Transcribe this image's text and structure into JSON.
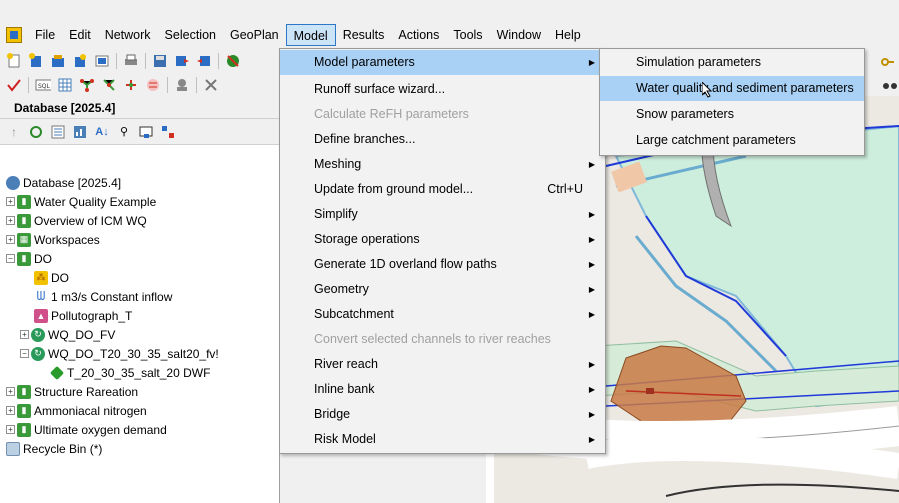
{
  "menubar": {
    "items": [
      {
        "label": "File",
        "active": false
      },
      {
        "label": "Edit",
        "active": false
      },
      {
        "label": "Network",
        "active": false
      },
      {
        "label": "Selection",
        "active": false
      },
      {
        "label": "GeoPlan",
        "active": false
      },
      {
        "label": "Model",
        "active": true
      },
      {
        "label": "Results",
        "active": false
      },
      {
        "label": "Actions",
        "active": false
      },
      {
        "label": "Tools",
        "active": false
      },
      {
        "label": "Window",
        "active": false
      },
      {
        "label": "Help",
        "active": false
      }
    ]
  },
  "database_panel": {
    "title": "Database [2025.4]",
    "tree": [
      {
        "label": "Database [2025.4]",
        "icon": "database-icon"
      },
      {
        "label": "Water Quality Example",
        "icon": "model-group-icon"
      },
      {
        "label": "Overview of ICM WQ",
        "icon": "model-group-icon"
      },
      {
        "label": "Workspaces",
        "icon": "workspace-icon"
      },
      {
        "label": "DO",
        "icon": "model-group-icon"
      },
      {
        "label": "DO",
        "icon": "network-icon"
      },
      {
        "label": "1 m3/s Constant inflow",
        "icon": "inflow-icon"
      },
      {
        "label": "Pollutograph_T",
        "icon": "pollutograph-icon"
      },
      {
        "label": "WQ_DO_FV",
        "icon": "run-icon"
      },
      {
        "label": "WQ_DO_T20_30_35_salt20_fv!",
        "icon": "run-icon"
      },
      {
        "label": "T_20_30_35_salt_20 DWF",
        "icon": "simulation-icon"
      },
      {
        "label": "Structure Rareation",
        "icon": "model-group-icon"
      },
      {
        "label": "Ammoniacal nitrogen",
        "icon": "model-group-icon"
      },
      {
        "label": "Ultimate oxygen demand",
        "icon": "model-group-icon"
      },
      {
        "label": "Recycle Bin (*)",
        "icon": "recycle-bin-icon"
      }
    ]
  },
  "model_menu": {
    "items": [
      {
        "label": "Model parameters",
        "submenu": true,
        "highlighted": true,
        "disabled": false,
        "shortcut": ""
      },
      {
        "label": "Runoff surface wizard...",
        "submenu": false,
        "highlighted": false,
        "disabled": false,
        "shortcut": ""
      },
      {
        "label": "Calculate ReFH parameters",
        "submenu": false,
        "highlighted": false,
        "disabled": true,
        "shortcut": ""
      },
      {
        "label": "Define branches...",
        "submenu": false,
        "highlighted": false,
        "disabled": false,
        "shortcut": ""
      },
      {
        "label": "Meshing",
        "submenu": true,
        "highlighted": false,
        "disabled": false,
        "shortcut": ""
      },
      {
        "label": "Update from ground model...",
        "submenu": false,
        "highlighted": false,
        "disabled": false,
        "shortcut": "Ctrl+U"
      },
      {
        "label": "Simplify",
        "submenu": true,
        "highlighted": false,
        "disabled": false,
        "shortcut": ""
      },
      {
        "label": "Storage operations",
        "submenu": true,
        "highlighted": false,
        "disabled": false,
        "shortcut": ""
      },
      {
        "label": "Generate 1D overland flow paths",
        "submenu": true,
        "highlighted": false,
        "disabled": false,
        "shortcut": ""
      },
      {
        "label": "Geometry",
        "submenu": true,
        "highlighted": false,
        "disabled": false,
        "shortcut": ""
      },
      {
        "label": "Subcatchment",
        "submenu": true,
        "highlighted": false,
        "disabled": false,
        "shortcut": ""
      },
      {
        "label": "Convert selected channels to river reaches",
        "submenu": false,
        "highlighted": false,
        "disabled": true,
        "shortcut": ""
      },
      {
        "label": "River reach",
        "submenu": true,
        "highlighted": false,
        "disabled": false,
        "shortcut": ""
      },
      {
        "label": "Inline bank",
        "submenu": true,
        "highlighted": false,
        "disabled": false,
        "shortcut": ""
      },
      {
        "label": "Bridge",
        "submenu": true,
        "highlighted": false,
        "disabled": false,
        "shortcut": ""
      },
      {
        "label": "Risk Model",
        "submenu": true,
        "highlighted": false,
        "disabled": false,
        "shortcut": ""
      }
    ]
  },
  "model_parameters_submenu": {
    "items": [
      {
        "label": "Simulation parameters",
        "highlighted": false
      },
      {
        "label": "Water quality and sediment parameters",
        "highlighted": true
      },
      {
        "label": "Snow parameters",
        "highlighted": false
      },
      {
        "label": "Large catchment parameters",
        "highlighted": false
      }
    ]
  },
  "colors": {
    "menu_highlight": "#a9d1f5",
    "active_menu_border": "#2f76c6",
    "map_green": "#c8ecd8",
    "map_polygon": "#c97a45",
    "map_line_blue": "#1f3ad8"
  }
}
